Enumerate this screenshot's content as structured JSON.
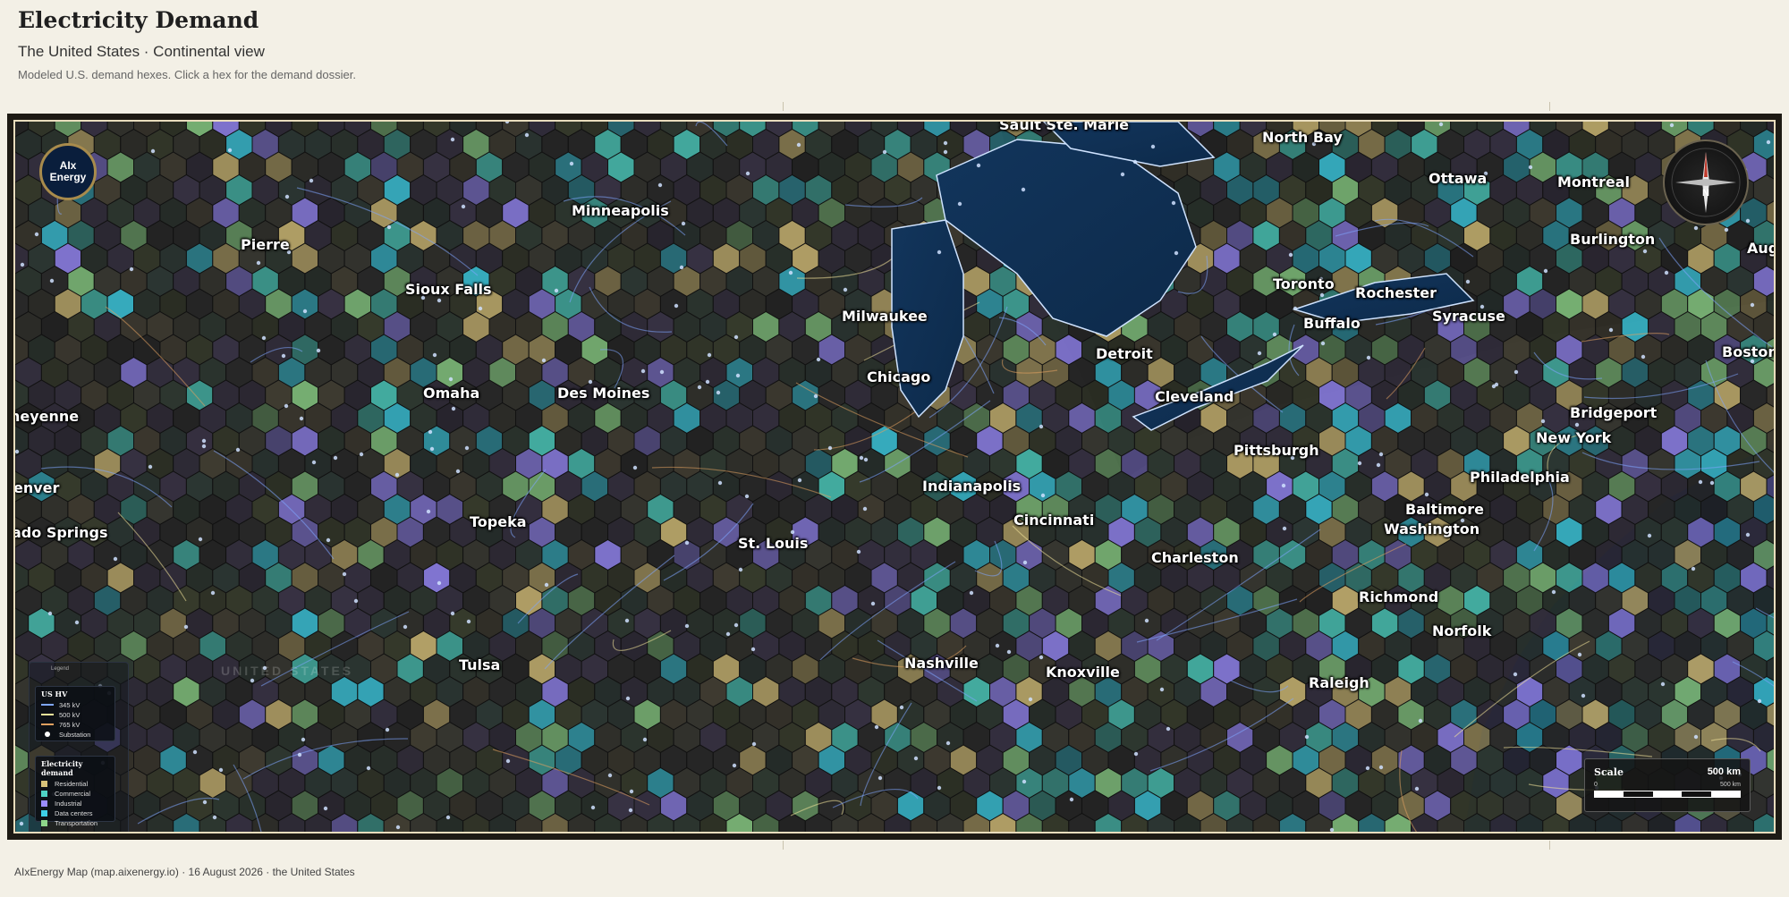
{
  "header": {
    "title": "Electricity Demand",
    "subtitle": "The United States · Continental view",
    "description": "Modeled U.S. demand hexes. Click a hex for the demand dossier."
  },
  "logo": {
    "line1": "AIx",
    "line2": "Energy",
    "icon": "aix-energy-logo"
  },
  "compass": {
    "label": "N",
    "icon": "compass-rose-icon"
  },
  "watermark": "UNITED STATES",
  "cities": [
    {
      "name": "Sault Ste. Marie"
    },
    {
      "name": "North Bay"
    },
    {
      "name": "Ottawa"
    },
    {
      "name": "Montreal"
    },
    {
      "name": "Minneapolis"
    },
    {
      "name": "Pierre"
    },
    {
      "name": "Burlington"
    },
    {
      "name": "Aug"
    },
    {
      "name": "Sioux Falls"
    },
    {
      "name": "Toronto"
    },
    {
      "name": "Rochester"
    },
    {
      "name": "Milwaukee"
    },
    {
      "name": "Syracuse"
    },
    {
      "name": "Buffalo"
    },
    {
      "name": "Boston"
    },
    {
      "name": "Detroit"
    },
    {
      "name": "Chicago"
    },
    {
      "name": "Omaha"
    },
    {
      "name": "Des Moines"
    },
    {
      "name": "Cleveland"
    },
    {
      "name": "heyenne"
    },
    {
      "name": "Bridgeport"
    },
    {
      "name": "New York"
    },
    {
      "name": "Pittsburgh"
    },
    {
      "name": "Philadelphia"
    },
    {
      "name": "enver"
    },
    {
      "name": "Indianapolis"
    },
    {
      "name": "Baltimore"
    },
    {
      "name": "Cincinnati"
    },
    {
      "name": "Topeka"
    },
    {
      "name": "ado Springs"
    },
    {
      "name": "Washington"
    },
    {
      "name": "St. Louis"
    },
    {
      "name": "Charleston"
    },
    {
      "name": "Richmond"
    },
    {
      "name": "Norfolk"
    },
    {
      "name": "Tulsa"
    },
    {
      "name": "Nashville"
    },
    {
      "name": "Knoxville"
    },
    {
      "name": "Raleigh"
    }
  ],
  "legend": {
    "title": "Legend",
    "hv": {
      "heading": "US HV",
      "items": [
        {
          "label": "345 kV",
          "color": "#7fa6ff"
        },
        {
          "label": "500 kV",
          "color": "#f2e39a"
        },
        {
          "label": "765 kV",
          "color": "#e0a060"
        },
        {
          "label": "Substation",
          "color": "#ffffff"
        }
      ]
    },
    "demand": {
      "heading": "Electricity demand",
      "items": [
        {
          "label": "Residential",
          "color": "#d8c27a"
        },
        {
          "label": "Commercial",
          "color": "#4fd3c4"
        },
        {
          "label": "Industrial",
          "color": "#9b8cff"
        },
        {
          "label": "Data centers",
          "color": "#3ecfe6"
        },
        {
          "label": "Transportation",
          "color": "#8fd68a"
        }
      ]
    }
  },
  "scale": {
    "label": "Scale",
    "value": "500 km",
    "zero": "0",
    "end": "500 km"
  },
  "footer": "AIxEnergy Map (map.aixenergy.io) · 16 August 2026 · the United States"
}
